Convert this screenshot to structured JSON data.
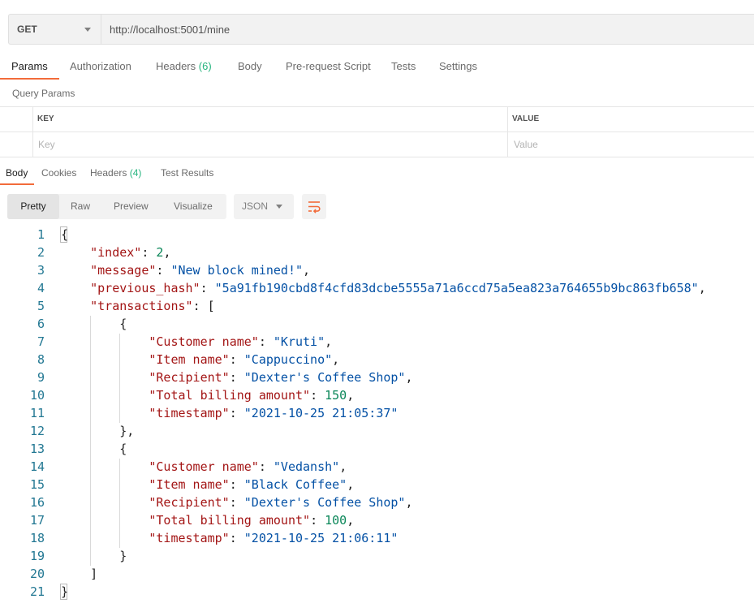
{
  "request": {
    "method": "GET",
    "url": "http://localhost:5001/mine"
  },
  "request_tabs": {
    "params": "Params",
    "authorization": "Authorization",
    "headers": "Headers",
    "headers_count": "(6)",
    "body": "Body",
    "pre_request_script": "Pre-request Script",
    "tests": "Tests",
    "settings": "Settings"
  },
  "query_params": {
    "title": "Query Params",
    "key_header": "KEY",
    "value_header": "VALUE",
    "key_placeholder": "Key",
    "value_placeholder": "Value"
  },
  "response_tabs": {
    "body": "Body",
    "cookies": "Cookies",
    "headers": "Headers",
    "headers_count": "(4)",
    "test_results": "Test Results"
  },
  "view_options": {
    "pretty": "Pretty",
    "raw": "Raw",
    "preview": "Preview",
    "visualize": "Visualize",
    "format": "JSON"
  },
  "icons": {
    "method_dropdown": "chevron-down-icon",
    "format_dropdown": "chevron-down-icon",
    "wrap": "wrap-lines-icon"
  },
  "colors": {
    "accent": "#f26b3a",
    "count": "#26b47f",
    "json_key": "#a31515",
    "json_string": "#0451a5",
    "json_number": "#098658",
    "line_number": "#237893"
  },
  "response_body": {
    "lines": [
      {
        "n": "1",
        "t": [
          [
            "p",
            "{"
          ]
        ]
      },
      {
        "n": "2",
        "t": [
          [
            "p",
            "    "
          ],
          [
            "k",
            "\"index\""
          ],
          [
            "p",
            ": "
          ],
          [
            "m",
            "2"
          ],
          [
            "p",
            ","
          ]
        ]
      },
      {
        "n": "3",
        "t": [
          [
            "p",
            "    "
          ],
          [
            "k",
            "\"message\""
          ],
          [
            "p",
            ": "
          ],
          [
            "s",
            "\"New block mined!\""
          ],
          [
            "p",
            ","
          ]
        ]
      },
      {
        "n": "4",
        "t": [
          [
            "p",
            "    "
          ],
          [
            "k",
            "\"previous_hash\""
          ],
          [
            "p",
            ": "
          ],
          [
            "s",
            "\"5a91fb190cbd8f4cfd83dcbe5555a71a6ccd75a5ea823a764655b9bc863fb658\""
          ],
          [
            "p",
            ","
          ]
        ]
      },
      {
        "n": "5",
        "t": [
          [
            "p",
            "    "
          ],
          [
            "k",
            "\"transactions\""
          ],
          [
            "p",
            ": ["
          ]
        ]
      },
      {
        "n": "6",
        "t": [
          [
            "p",
            "        {"
          ]
        ]
      },
      {
        "n": "7",
        "t": [
          [
            "p",
            "            "
          ],
          [
            "k",
            "\"Customer name\""
          ],
          [
            "p",
            ": "
          ],
          [
            "s",
            "\"Kruti\""
          ],
          [
            "p",
            ","
          ]
        ]
      },
      {
        "n": "8",
        "t": [
          [
            "p",
            "            "
          ],
          [
            "k",
            "\"Item name\""
          ],
          [
            "p",
            ": "
          ],
          [
            "s",
            "\"Cappuccino\""
          ],
          [
            "p",
            ","
          ]
        ]
      },
      {
        "n": "9",
        "t": [
          [
            "p",
            "            "
          ],
          [
            "k",
            "\"Recipient\""
          ],
          [
            "p",
            ": "
          ],
          [
            "s",
            "\"Dexter's Coffee Shop\""
          ],
          [
            "p",
            ","
          ]
        ]
      },
      {
        "n": "10",
        "t": [
          [
            "p",
            "            "
          ],
          [
            "k",
            "\"Total billing amount\""
          ],
          [
            "p",
            ": "
          ],
          [
            "m",
            "150"
          ],
          [
            "p",
            ","
          ]
        ]
      },
      {
        "n": "11",
        "t": [
          [
            "p",
            "            "
          ],
          [
            "k",
            "\"timestamp\""
          ],
          [
            "p",
            ": "
          ],
          [
            "s",
            "\"2021-10-25 21:05:37\""
          ]
        ]
      },
      {
        "n": "12",
        "t": [
          [
            "p",
            "        },"
          ]
        ]
      },
      {
        "n": "13",
        "t": [
          [
            "p",
            "        {"
          ]
        ]
      },
      {
        "n": "14",
        "t": [
          [
            "p",
            "            "
          ],
          [
            "k",
            "\"Customer name\""
          ],
          [
            "p",
            ": "
          ],
          [
            "s",
            "\"Vedansh\""
          ],
          [
            "p",
            ","
          ]
        ]
      },
      {
        "n": "15",
        "t": [
          [
            "p",
            "            "
          ],
          [
            "k",
            "\"Item name\""
          ],
          [
            "p",
            ": "
          ],
          [
            "s",
            "\"Black Coffee\""
          ],
          [
            "p",
            ","
          ]
        ]
      },
      {
        "n": "16",
        "t": [
          [
            "p",
            "            "
          ],
          [
            "k",
            "\"Recipient\""
          ],
          [
            "p",
            ": "
          ],
          [
            "s",
            "\"Dexter's Coffee Shop\""
          ],
          [
            "p",
            ","
          ]
        ]
      },
      {
        "n": "17",
        "t": [
          [
            "p",
            "            "
          ],
          [
            "k",
            "\"Total billing amount\""
          ],
          [
            "p",
            ": "
          ],
          [
            "m",
            "100"
          ],
          [
            "p",
            ","
          ]
        ]
      },
      {
        "n": "18",
        "t": [
          [
            "p",
            "            "
          ],
          [
            "k",
            "\"timestamp\""
          ],
          [
            "p",
            ": "
          ],
          [
            "s",
            "\"2021-10-25 21:06:11\""
          ]
        ]
      },
      {
        "n": "19",
        "t": [
          [
            "p",
            "        }"
          ]
        ]
      },
      {
        "n": "20",
        "t": [
          [
            "p",
            "    ]"
          ]
        ]
      },
      {
        "n": "21",
        "t": [
          [
            "p",
            "}"
          ]
        ]
      }
    ]
  }
}
